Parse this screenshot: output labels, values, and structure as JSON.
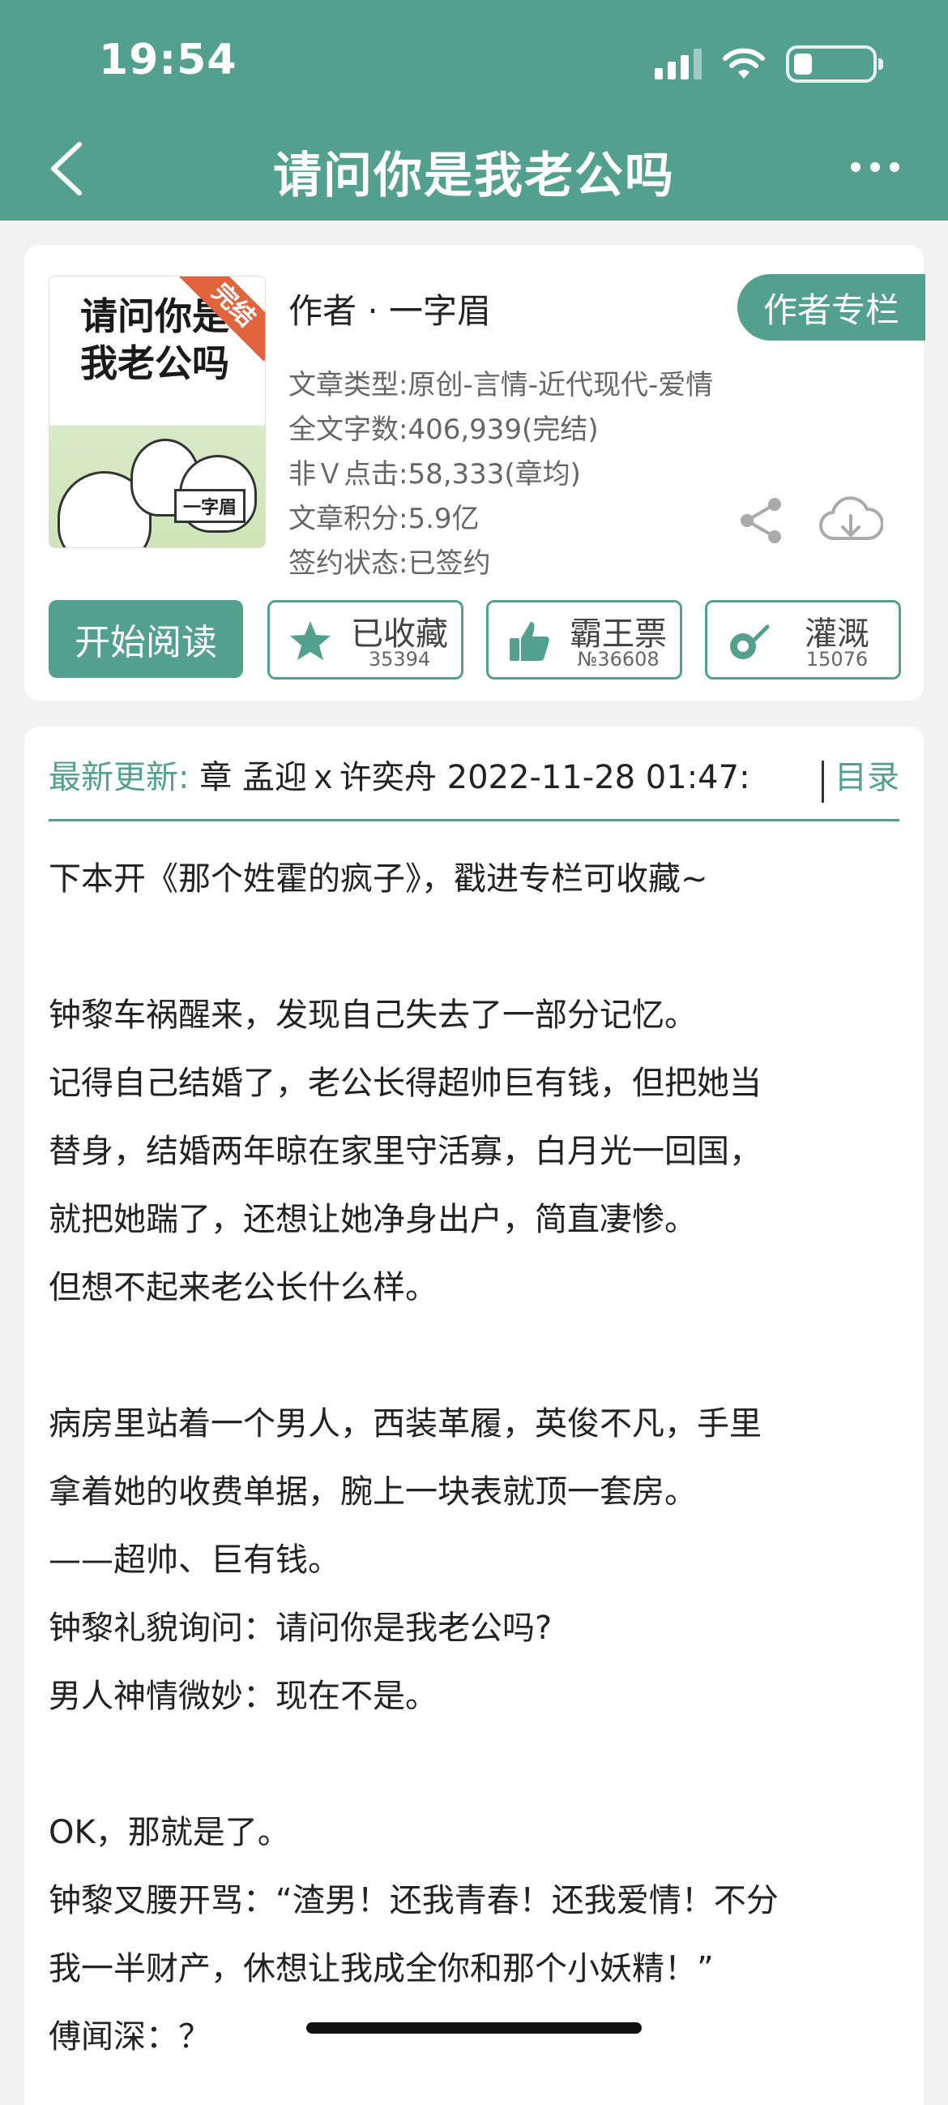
{
  "status": {
    "time": "19:54"
  },
  "nav": {
    "title": "请问你是我老公吗"
  },
  "book": {
    "cover": {
      "title": "请问你是我老公吗",
      "badge": "完结",
      "author_tag": "一字眉"
    },
    "author_line": "作者 · 一字眉",
    "author_column_label": "作者专栏",
    "meta": [
      "文章类型:原创-言情-近代现代-爱情",
      "全文字数:406,939(完结)",
      "非Ｖ点击:58,333(章均)",
      "文章积分:5.9亿",
      "签约状态:已签约"
    ]
  },
  "actions": {
    "read_label": "开始阅读",
    "collect": {
      "label": "已收藏",
      "count": "35394"
    },
    "vote": {
      "label": "霸王票",
      "count": "№36608"
    },
    "water": {
      "label": "灌溉",
      "count": "15076"
    }
  },
  "update": {
    "label": "最新更新:",
    "text": "章 孟迎ｘ许奕舟 2022-11-28 01:47:",
    "toc_label": "目录"
  },
  "intro": [
    "下本开《那个姓霍的疯子》，戳进专栏可收藏~",
    "",
    "钟黎车祸醒来，发现自己失去了一部分记忆。",
    "记得自己结婚了，老公长得超帅巨有钱，但把她当",
    "替身，结婚两年晾在家里守活寡，白月光一回国，",
    "就把她踹了，还想让她净身出户，简直凄惨。",
    "但想不起来老公长什么样。",
    "",
    "病房里站着一个男人，西装革履，英俊不凡，手里",
    "拿着她的收费单据，腕上一块表就顶一套房。",
    "——超帅、巨有钱。",
    "钟黎礼貌询问：请问你是我老公吗?",
    "男人神情微妙：现在不是。",
    "",
    "OK，那就是了。",
    "钟黎叉腰开骂：“渣男！还我青春！还我爱情！不分",
    "我一半财产，休想让我成全你和那个小妖精！”",
    "傅闻深：？"
  ],
  "colors": {
    "accent": "#54a08e",
    "ribbon": "#e0643c"
  }
}
